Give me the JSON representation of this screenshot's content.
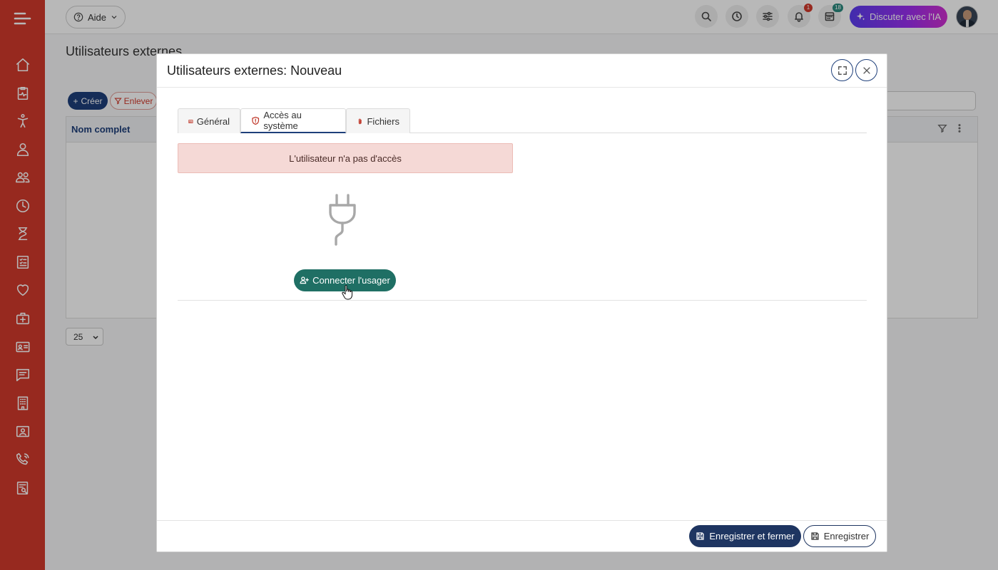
{
  "topbar": {
    "help_label": "Aide",
    "notifications_count": "1",
    "calendar_count": "18",
    "ai_label": "Discuter avec l'IA"
  },
  "background": {
    "page_title": "Utilisateurs externes",
    "create_label": "Créer",
    "remove_label": "Enlever",
    "column_fullname": "Nom complet",
    "page_size": "25"
  },
  "modal": {
    "title": "Utilisateurs externes: Nouveau",
    "tabs": [
      {
        "label": "Général"
      },
      {
        "label": "Accès au système"
      },
      {
        "label": "Fichiers"
      }
    ],
    "active_tab": "Accès au système",
    "alert_text": "L'utilisateur n'a pas d'accès",
    "connect_label": "Connecter l'usager",
    "save_close_label": "Enregistrer et fermer",
    "save_label": "Enregistrer"
  },
  "colors": {
    "sidebar": "#d13a2c",
    "primary": "#1e3561",
    "connect": "#1f6f64",
    "alert_bg": "#f5d9d6"
  },
  "icons": {
    "sidebar": [
      "home-icon",
      "activity-icon",
      "accessibility-icon",
      "user-icon",
      "users-icon",
      "clock-icon",
      "hourglass-icon",
      "checklist-icon",
      "heart-icon",
      "medical-kit-icon",
      "id-card-icon",
      "message-icon",
      "building-icon",
      "presentation-icon",
      "phone-icon",
      "report-icon"
    ]
  }
}
